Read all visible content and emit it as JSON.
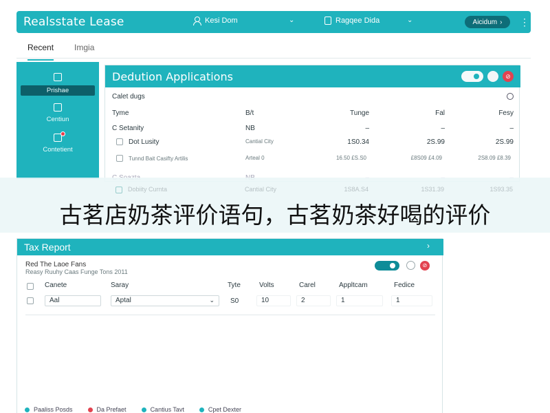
{
  "app": {
    "title": "Realsstate Lease"
  },
  "header": {
    "user_label": "Kesi Dom",
    "doc_label": "Ragqee Dida",
    "account_label": "Aicidum",
    "account_arrow": "›",
    "more_icon": "⋮"
  },
  "tabs": [
    {
      "label": "Recent",
      "active": true
    },
    {
      "label": "Imgia",
      "active": false
    }
  ],
  "sidebar": {
    "items": [
      {
        "label": "Prishae",
        "icon": "building-icon",
        "active": true
      },
      {
        "label": "Centiun",
        "icon": "document-icon",
        "active": false
      },
      {
        "label": "Contetient",
        "icon": "message-icon",
        "active": false
      }
    ]
  },
  "deduction": {
    "title": "Dedution Applications",
    "subtitle": "Calet dugs",
    "red_button": "⊘",
    "columns": {
      "type": "Tyme",
      "br": "B/t",
      "tun": "Tunge",
      "fal": "Fal",
      "fes": "Fesy"
    },
    "rows": [
      {
        "type": "C Setanity",
        "br": "NB",
        "tun": "–",
        "fal": "–",
        "fes": "–"
      },
      {
        "type": "Dot Lusity",
        "br": "Cantial City",
        "tun": "1S0.34",
        "fal": "2S.99",
        "fes": "2S.99"
      },
      {
        "type": "Tunnd Bait Casifty Artilis",
        "br": "Arteal 0",
        "tun": "16.50 £S.S0",
        "fal": "£8S09 £4.09",
        "fes": "2S8.09 £8.39"
      },
      {
        "type": "C Soazta",
        "br": "NB",
        "tun": "–",
        "fal": "–",
        "fes": "–"
      },
      {
        "type": "Dobiity Curnta",
        "br": "Cantial City",
        "tun": "1S8A.S4",
        "fal": "1S31.39",
        "fes": "1S93.35"
      }
    ]
  },
  "banner": {
    "text": "古茗店奶茶评价语句，古茗奶茶好喝的评价"
  },
  "tax_report": {
    "title": "Tax Report",
    "arrow": "›",
    "line1": "Red The Laoe Fans",
    "line2": "Reasy Ruuhy Caas Funge Tons 2011",
    "red_button": "⊘",
    "columns": {
      "c1": "Canete",
      "c2": "Saray",
      "c3": "Tyte",
      "c4": "Volts",
      "c5": "Carel",
      "c6": "Appltcam",
      "c7": "Fedice"
    },
    "row": {
      "c1": "Aal",
      "c2": "Aptal",
      "c3": "S0",
      "c4": "10",
      "c5": "2",
      "c6": "1",
      "c7": "1"
    }
  },
  "legend": [
    {
      "label": "Paaliss Posds",
      "color": "#1fb3bd"
    },
    {
      "label": "Da Prefaet",
      "color": "#e24350"
    },
    {
      "label": "Cantius Tavt",
      "color": "#1fb3bd"
    },
    {
      "label": "Cpet Dexter",
      "color": "#1fb3bd"
    }
  ]
}
